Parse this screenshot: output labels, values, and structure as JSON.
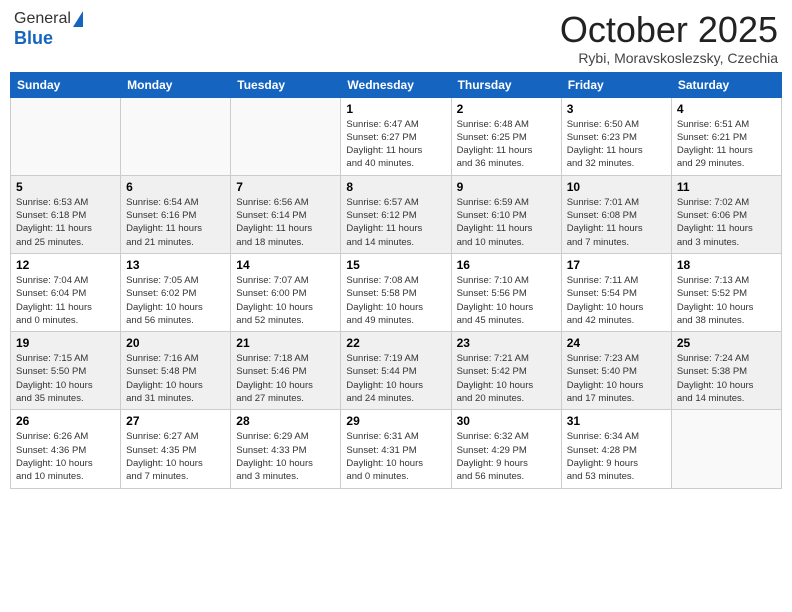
{
  "header": {
    "logo_general": "General",
    "logo_blue": "Blue",
    "month_title": "October 2025",
    "location": "Rybi, Moravskoslezsky, Czechia"
  },
  "days_of_week": [
    "Sunday",
    "Monday",
    "Tuesday",
    "Wednesday",
    "Thursday",
    "Friday",
    "Saturday"
  ],
  "weeks": [
    {
      "shaded": false,
      "days": [
        {
          "num": "",
          "info": ""
        },
        {
          "num": "",
          "info": ""
        },
        {
          "num": "",
          "info": ""
        },
        {
          "num": "1",
          "info": "Sunrise: 6:47 AM\nSunset: 6:27 PM\nDaylight: 11 hours\nand 40 minutes."
        },
        {
          "num": "2",
          "info": "Sunrise: 6:48 AM\nSunset: 6:25 PM\nDaylight: 11 hours\nand 36 minutes."
        },
        {
          "num": "3",
          "info": "Sunrise: 6:50 AM\nSunset: 6:23 PM\nDaylight: 11 hours\nand 32 minutes."
        },
        {
          "num": "4",
          "info": "Sunrise: 6:51 AM\nSunset: 6:21 PM\nDaylight: 11 hours\nand 29 minutes."
        }
      ]
    },
    {
      "shaded": true,
      "days": [
        {
          "num": "5",
          "info": "Sunrise: 6:53 AM\nSunset: 6:18 PM\nDaylight: 11 hours\nand 25 minutes."
        },
        {
          "num": "6",
          "info": "Sunrise: 6:54 AM\nSunset: 6:16 PM\nDaylight: 11 hours\nand 21 minutes."
        },
        {
          "num": "7",
          "info": "Sunrise: 6:56 AM\nSunset: 6:14 PM\nDaylight: 11 hours\nand 18 minutes."
        },
        {
          "num": "8",
          "info": "Sunrise: 6:57 AM\nSunset: 6:12 PM\nDaylight: 11 hours\nand 14 minutes."
        },
        {
          "num": "9",
          "info": "Sunrise: 6:59 AM\nSunset: 6:10 PM\nDaylight: 11 hours\nand 10 minutes."
        },
        {
          "num": "10",
          "info": "Sunrise: 7:01 AM\nSunset: 6:08 PM\nDaylight: 11 hours\nand 7 minutes."
        },
        {
          "num": "11",
          "info": "Sunrise: 7:02 AM\nSunset: 6:06 PM\nDaylight: 11 hours\nand 3 minutes."
        }
      ]
    },
    {
      "shaded": false,
      "days": [
        {
          "num": "12",
          "info": "Sunrise: 7:04 AM\nSunset: 6:04 PM\nDaylight: 11 hours\nand 0 minutes."
        },
        {
          "num": "13",
          "info": "Sunrise: 7:05 AM\nSunset: 6:02 PM\nDaylight: 10 hours\nand 56 minutes."
        },
        {
          "num": "14",
          "info": "Sunrise: 7:07 AM\nSunset: 6:00 PM\nDaylight: 10 hours\nand 52 minutes."
        },
        {
          "num": "15",
          "info": "Sunrise: 7:08 AM\nSunset: 5:58 PM\nDaylight: 10 hours\nand 49 minutes."
        },
        {
          "num": "16",
          "info": "Sunrise: 7:10 AM\nSunset: 5:56 PM\nDaylight: 10 hours\nand 45 minutes."
        },
        {
          "num": "17",
          "info": "Sunrise: 7:11 AM\nSunset: 5:54 PM\nDaylight: 10 hours\nand 42 minutes."
        },
        {
          "num": "18",
          "info": "Sunrise: 7:13 AM\nSunset: 5:52 PM\nDaylight: 10 hours\nand 38 minutes."
        }
      ]
    },
    {
      "shaded": true,
      "days": [
        {
          "num": "19",
          "info": "Sunrise: 7:15 AM\nSunset: 5:50 PM\nDaylight: 10 hours\nand 35 minutes."
        },
        {
          "num": "20",
          "info": "Sunrise: 7:16 AM\nSunset: 5:48 PM\nDaylight: 10 hours\nand 31 minutes."
        },
        {
          "num": "21",
          "info": "Sunrise: 7:18 AM\nSunset: 5:46 PM\nDaylight: 10 hours\nand 27 minutes."
        },
        {
          "num": "22",
          "info": "Sunrise: 7:19 AM\nSunset: 5:44 PM\nDaylight: 10 hours\nand 24 minutes."
        },
        {
          "num": "23",
          "info": "Sunrise: 7:21 AM\nSunset: 5:42 PM\nDaylight: 10 hours\nand 20 minutes."
        },
        {
          "num": "24",
          "info": "Sunrise: 7:23 AM\nSunset: 5:40 PM\nDaylight: 10 hours\nand 17 minutes."
        },
        {
          "num": "25",
          "info": "Sunrise: 7:24 AM\nSunset: 5:38 PM\nDaylight: 10 hours\nand 14 minutes."
        }
      ]
    },
    {
      "shaded": false,
      "days": [
        {
          "num": "26",
          "info": "Sunrise: 6:26 AM\nSunset: 4:36 PM\nDaylight: 10 hours\nand 10 minutes."
        },
        {
          "num": "27",
          "info": "Sunrise: 6:27 AM\nSunset: 4:35 PM\nDaylight: 10 hours\nand 7 minutes."
        },
        {
          "num": "28",
          "info": "Sunrise: 6:29 AM\nSunset: 4:33 PM\nDaylight: 10 hours\nand 3 minutes."
        },
        {
          "num": "29",
          "info": "Sunrise: 6:31 AM\nSunset: 4:31 PM\nDaylight: 10 hours\nand 0 minutes."
        },
        {
          "num": "30",
          "info": "Sunrise: 6:32 AM\nSunset: 4:29 PM\nDaylight: 9 hours\nand 56 minutes."
        },
        {
          "num": "31",
          "info": "Sunrise: 6:34 AM\nSunset: 4:28 PM\nDaylight: 9 hours\nand 53 minutes."
        },
        {
          "num": "",
          "info": ""
        }
      ]
    }
  ]
}
